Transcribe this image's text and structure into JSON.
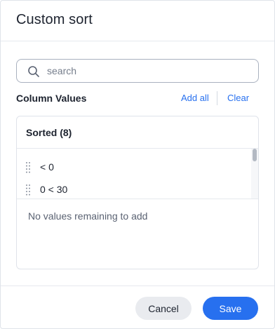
{
  "dialog": {
    "title": "Custom sort"
  },
  "search": {
    "placeholder": "search",
    "value": ""
  },
  "column_values": {
    "label": "Column Values",
    "add_all_label": "Add all",
    "clear_label": "Clear"
  },
  "sorted": {
    "title": "Sorted (8)",
    "items": [
      {
        "label": "< 0"
      },
      {
        "label": "0 < 30"
      }
    ]
  },
  "remaining": {
    "empty_text": "No values remaining to add"
  },
  "footer": {
    "cancel_label": "Cancel",
    "save_label": "Save"
  },
  "colors": {
    "accent": "#2770ef",
    "text": "#1d232f",
    "muted": "#767e8c",
    "border": "#dfe3ea",
    "cancel_bg": "#e9ebef"
  },
  "icons": {
    "search": "search-icon",
    "drag": "drag-handle-icon"
  }
}
